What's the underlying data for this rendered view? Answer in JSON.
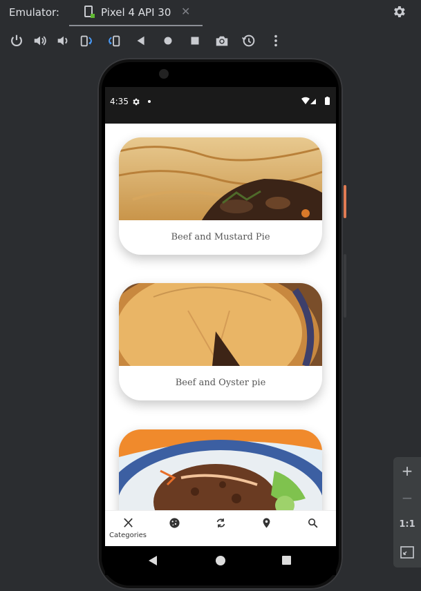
{
  "window": {
    "title": "Emulator:"
  },
  "tab": {
    "label": "Pixel 4 API 30",
    "close": "✕"
  },
  "toolbar": {
    "buttons": [
      "power-icon",
      "volume-up-icon",
      "volume-down-icon",
      "rotate-left-icon",
      "rotate-right-icon",
      "back-icon",
      "home-icon",
      "overview-icon",
      "camera-icon",
      "snapshot-icon",
      "more-icon"
    ]
  },
  "statusbar": {
    "time": "4:35"
  },
  "cards": [
    {
      "title": "Beef and Mustard Pie"
    },
    {
      "title": "Beef and Oyster pie"
    },
    {
      "title": ""
    }
  ],
  "bottom_nav": {
    "items": [
      {
        "icon": "utensils-icon",
        "label": "Categories"
      },
      {
        "icon": "cookie-icon",
        "label": ""
      },
      {
        "icon": "refresh-icon",
        "label": ""
      },
      {
        "icon": "location-pin-icon",
        "label": ""
      },
      {
        "icon": "search-icon",
        "label": ""
      }
    ]
  },
  "zoom_panel": {
    "zoom_in": "+",
    "zoom_out": "−",
    "one_to_one": "1:1"
  },
  "colors": {
    "accent_side_button": "#e07b53",
    "tab_indicator": "#8c8f96"
  }
}
